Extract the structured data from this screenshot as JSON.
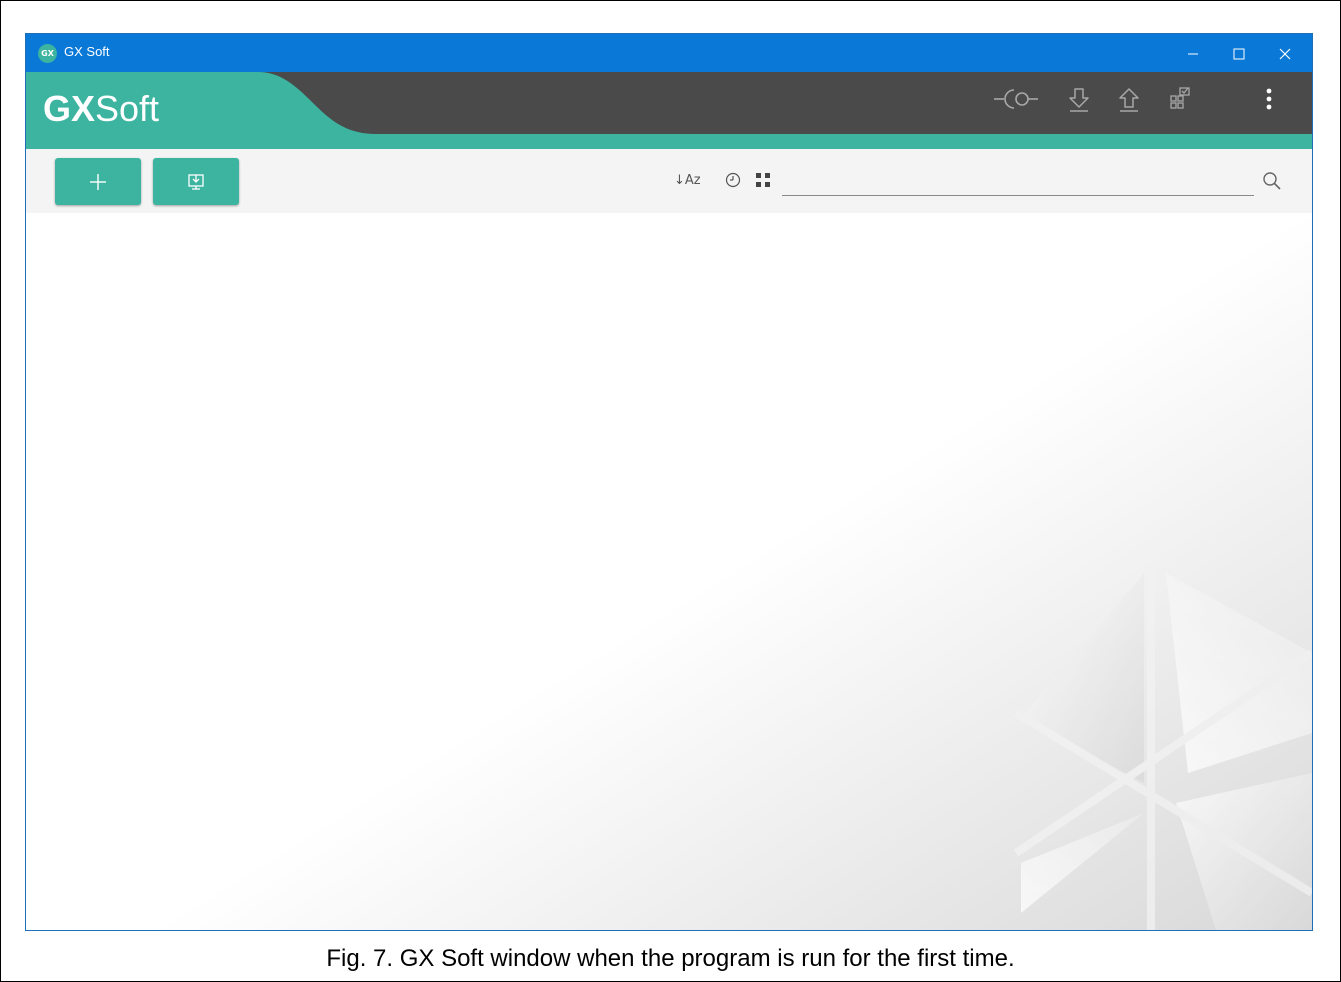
{
  "window": {
    "app_icon_text": "GX",
    "title": "GX Soft",
    "controls": {
      "minimize_icon": "minimize-icon",
      "maximize_icon": "maximize-icon",
      "close_icon": "close-icon"
    }
  },
  "header": {
    "logo_bold": "GX",
    "logo_regular": "Soft",
    "icons": [
      "connect-icon",
      "download-icon",
      "upload-icon",
      "modules-icon",
      "more-menu-icon"
    ]
  },
  "toolbar": {
    "add_icon": "plus-icon",
    "import_icon": "import-icon",
    "sort_label": "↓Az",
    "history_icon": "clock-icon",
    "view_icon": "grid-view-icon",
    "search_value": "",
    "search_icon": "search-icon"
  },
  "colors": {
    "titlebar": "#0a78d7",
    "accent": "#3cb4a0",
    "header_dark": "#4a4a4a",
    "toolbar_bg": "#f4f4f4"
  },
  "caption": "Fig. 7. GX Soft window when the program is run for the first time."
}
